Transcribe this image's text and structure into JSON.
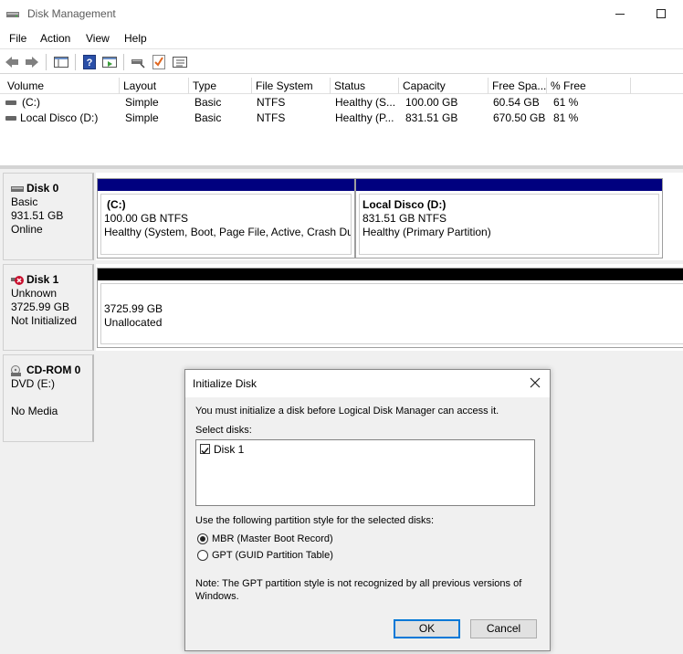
{
  "window": {
    "title": "Disk Management"
  },
  "menu": [
    "File",
    "Action",
    "View",
    "Help"
  ],
  "toolbar": {
    "icons": [
      "back-arrow-icon",
      "forward-arrow-icon",
      "console-tree-icon",
      "help-icon",
      "properties-icon",
      "rescan-icon",
      "checklist-icon",
      "settings-list-icon"
    ]
  },
  "volume_table": {
    "headers": [
      "Volume",
      "Layout",
      "Type",
      "File System",
      "Status",
      "Capacity",
      "Free Spa...",
      "% Free"
    ],
    "rows": [
      [
        "(C:)",
        "Simple",
        "Basic",
        "NTFS",
        "Healthy (S...",
        "100.00 GB",
        "60.54 GB",
        "61 %"
      ],
      [
        "Local Disco (D:)",
        "Simple",
        "Basic",
        "NTFS",
        "Healthy (P...",
        "831.51 GB",
        "670.50 GB",
        "81 %"
      ]
    ]
  },
  "disks": {
    "disk0": {
      "name": "Disk 0",
      "type": "Basic",
      "size": "931.51 GB",
      "state": "Online",
      "partitions": [
        {
          "label": "(C:)",
          "size": "100.00 GB NTFS",
          "status": "Healthy (System, Boot, Page File, Active, Crash Dur"
        },
        {
          "label": "Local Disco  (D:)",
          "size": "831.51 GB NTFS",
          "status": "Healthy (Primary Partition)"
        }
      ]
    },
    "disk1": {
      "name": "Disk 1",
      "type": "Unknown",
      "size": "3725.99 GB",
      "state": "Not Initialized",
      "partition": {
        "size": "3725.99 GB",
        "status": "Unallocated"
      }
    },
    "cdrom0": {
      "name": "CD-ROM 0",
      "type": "DVD (E:)",
      "state": "No Media"
    }
  },
  "dialog": {
    "title": "Initialize Disk",
    "intro": "You must initialize a disk before Logical Disk Manager can access it.",
    "select_label": "Select disks:",
    "disk_items": [
      {
        "label": "Disk 1",
        "checked": true
      }
    ],
    "style_label": "Use the following partition style for the selected disks:",
    "option_mbr": "MBR (Master Boot Record)",
    "option_gpt": "GPT (GUID Partition Table)",
    "selected_option": "MBR (Master Boot Record)",
    "note_line1": "Note: The GPT partition style is not recognized by all previous versions of",
    "note_line2": "Windows.",
    "ok": "OK",
    "cancel": "Cancel"
  },
  "colors": {
    "primary_bar": "#00007f",
    "unallocated_bar": "#000000",
    "accent": "#0078d7"
  }
}
